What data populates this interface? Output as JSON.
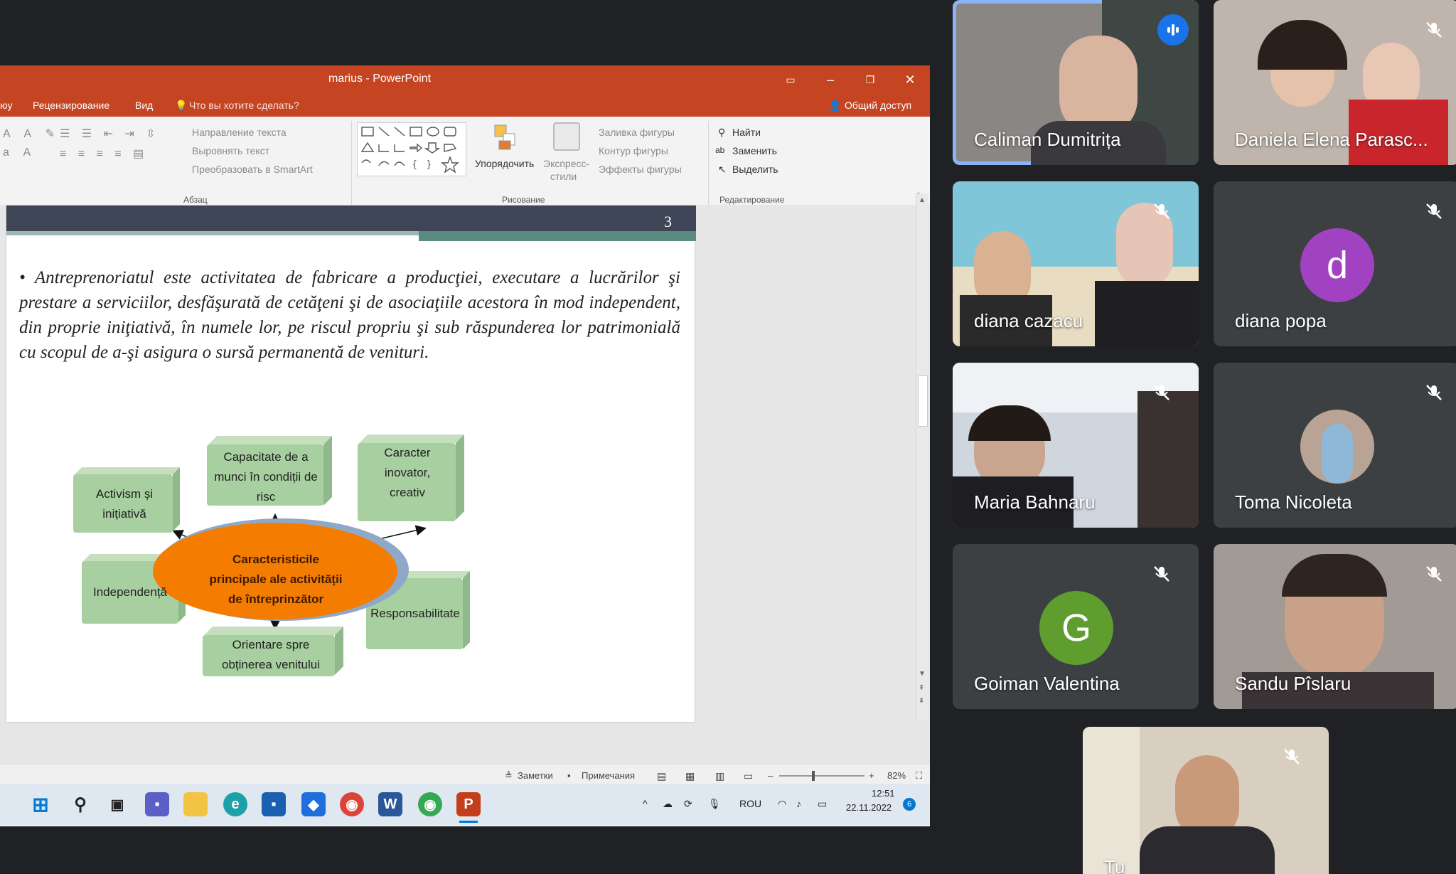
{
  "powerpoint": {
    "title": "marius - PowerPoint",
    "menu": [
      "юу",
      "Рецензирование",
      "Вид",
      "Что вы хотите сделать?"
    ],
    "share_label": "Общий доступ",
    "ribbon": {
      "paragraph_items": [
        "Направление текста",
        "Выровнять текст",
        "Преобразовать в SmartArt"
      ],
      "paragraph_group": "Абзац",
      "arrange_label": "Упорядочить",
      "express_label": "Экспресс-",
      "express_label2": "стили",
      "shape_fill": "Заливка фигуры",
      "shape_outline": "Контур фигуры",
      "shape_effects": "Эффекты фигуры",
      "drawing_group": "Рисование",
      "find": "Найти",
      "replace": "Заменить",
      "select": "Выделить",
      "editing_group": "Редактирование"
    },
    "slide": {
      "number": "3",
      "text": "• Antreprenoriatul este activitatea de fabricare a producţiei, executare a lucrărilor şi prestare a serviciilor, desfăşurată de cetăţeni şi de asociaţiile acestora în mod independent, din proprie iniţiativă, în numele lor, pe riscul propriu şi sub răspunderea lor patrimonială cu scopul de a-şi asigura o sursă permanentă de venituri.",
      "center": "Caracteristicile principale ale activității de întreprinzător",
      "boxes": [
        "Activism și inițiativă",
        "Capacitate de a munci în condiții de risc",
        "Caracter inovator, creativ",
        "Independență",
        "Responsabilitate",
        "Orientare spre obținerea venitului"
      ]
    },
    "status": {
      "notes": "Заметки",
      "comments": "Примечания",
      "zoom": "82%"
    }
  },
  "taskbar": {
    "lang": "ROU",
    "time": "12:51",
    "date": "22.11.2022",
    "notif_count": "6"
  },
  "participants": [
    {
      "name": "Caliman Dumitrița",
      "speaking": true
    },
    {
      "name": "Daniela Elena Parasc...",
      "muted": true
    },
    {
      "name": "diana cazacu",
      "muted": true
    },
    {
      "name": "diana popa",
      "muted": true,
      "initial": "d",
      "color": "#a142c3"
    },
    {
      "name": "Maria Bahnaru",
      "muted": true
    },
    {
      "name": "Toma Nicoleta",
      "muted": true
    },
    {
      "name": "Goiman Valentina",
      "muted": true,
      "initial": "G",
      "color": "#5f9e2e"
    },
    {
      "name": "Sandu Pîslaru",
      "muted": true
    },
    {
      "name": "Tu",
      "muted": true
    }
  ]
}
